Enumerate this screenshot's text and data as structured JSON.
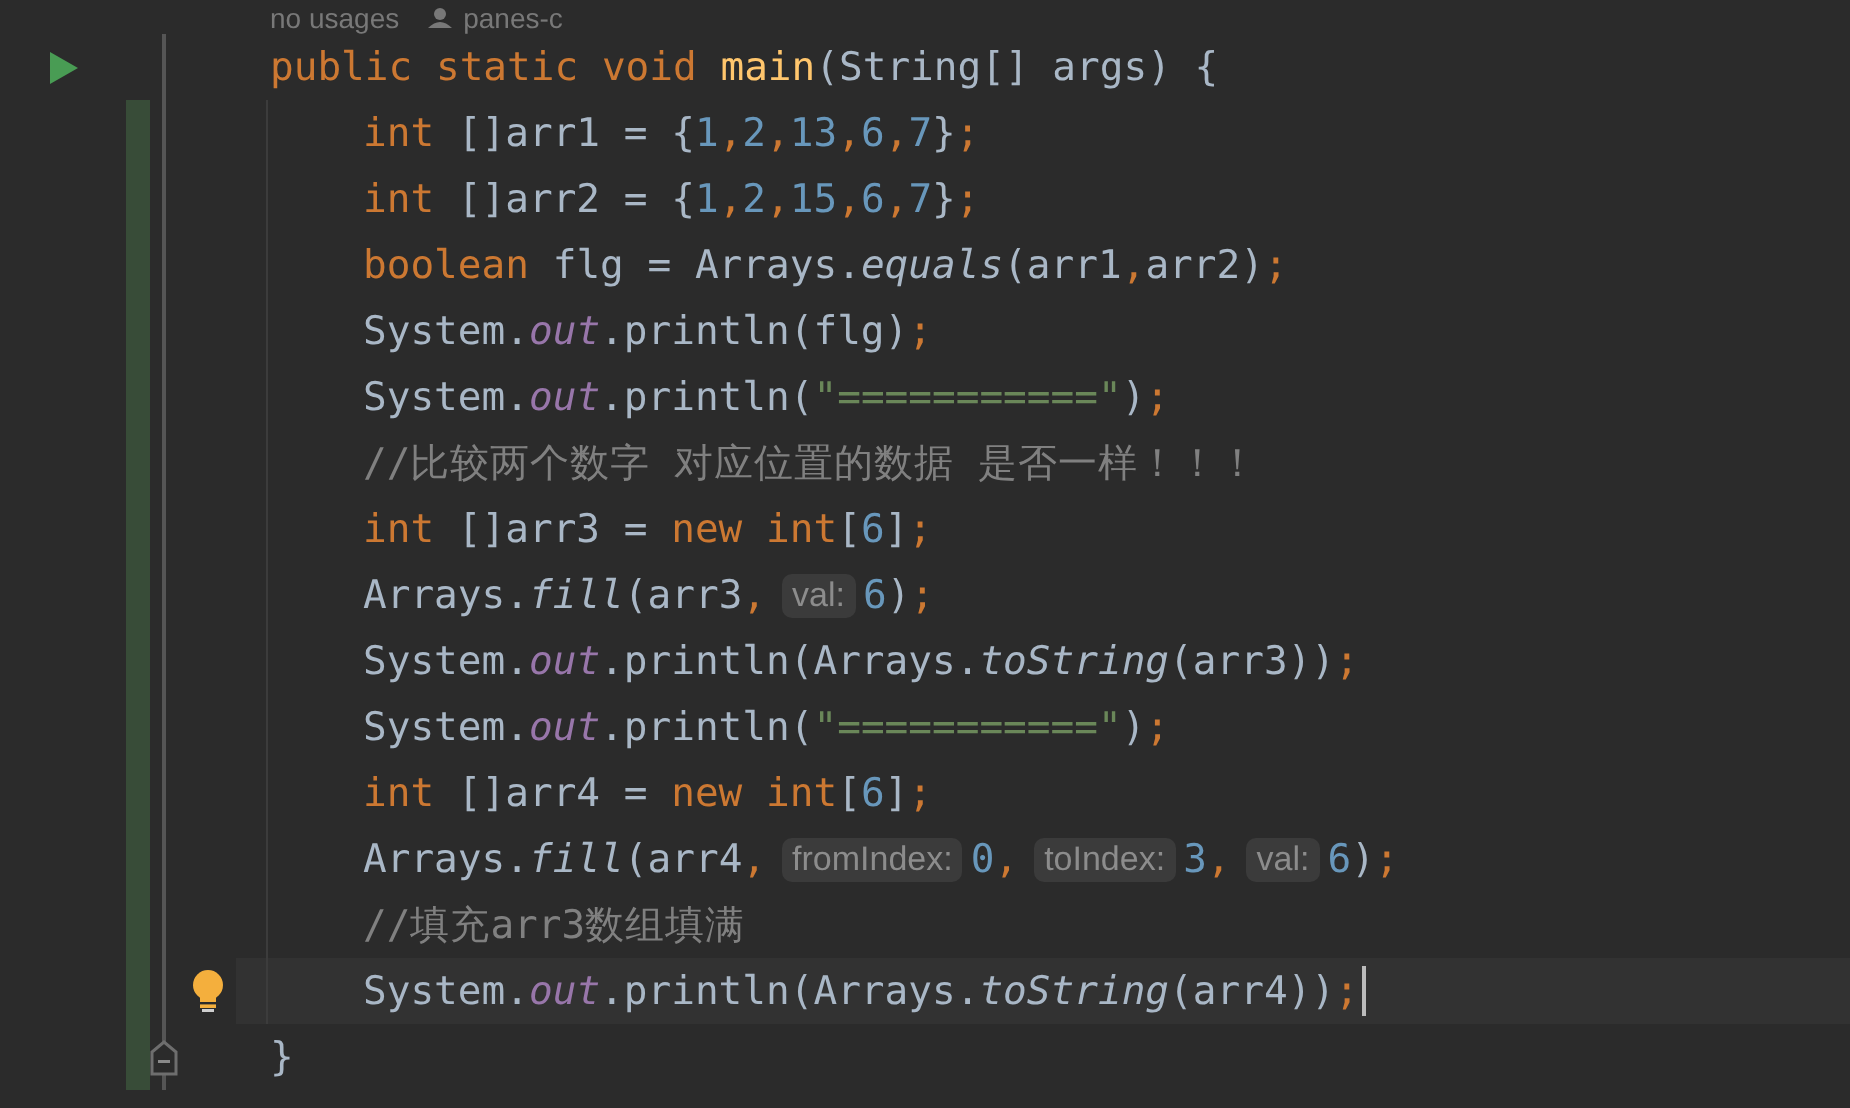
{
  "header": {
    "usages": "no usages",
    "author": "panes-c"
  },
  "lines": [
    {
      "marker": {
        "kind": "run"
      },
      "indented": false,
      "changed": false,
      "current": false,
      "tokens": [
        {
          "kind": "kw",
          "text": "public static void "
        },
        {
          "kind": "method",
          "text": "main"
        },
        {
          "kind": "plain",
          "text": "(String[] args) {"
        }
      ]
    },
    {
      "indented": true,
      "changed": true,
      "current": false,
      "tokens": [
        {
          "kind": "kw",
          "text": "int"
        },
        {
          "kind": "plain",
          "text": " []arr1 = {"
        },
        {
          "kind": "num",
          "text": "1"
        },
        {
          "kind": "kw",
          "text": ","
        },
        {
          "kind": "num",
          "text": "2"
        },
        {
          "kind": "kw",
          "text": ","
        },
        {
          "kind": "num",
          "text": "13"
        },
        {
          "kind": "kw",
          "text": ","
        },
        {
          "kind": "num",
          "text": "6"
        },
        {
          "kind": "kw",
          "text": ","
        },
        {
          "kind": "num",
          "text": "7"
        },
        {
          "kind": "plain",
          "text": "}"
        },
        {
          "kind": "kw",
          "text": ";"
        }
      ]
    },
    {
      "indented": true,
      "changed": true,
      "current": false,
      "tokens": [
        {
          "kind": "kw",
          "text": "int"
        },
        {
          "kind": "plain",
          "text": " []arr2 = {"
        },
        {
          "kind": "num",
          "text": "1"
        },
        {
          "kind": "kw",
          "text": ","
        },
        {
          "kind": "num",
          "text": "2"
        },
        {
          "kind": "kw",
          "text": ","
        },
        {
          "kind": "num",
          "text": "15"
        },
        {
          "kind": "kw",
          "text": ","
        },
        {
          "kind": "num",
          "text": "6"
        },
        {
          "kind": "kw",
          "text": ","
        },
        {
          "kind": "num",
          "text": "7"
        },
        {
          "kind": "plain",
          "text": "}"
        },
        {
          "kind": "kw",
          "text": ";"
        }
      ]
    },
    {
      "indented": true,
      "changed": true,
      "current": false,
      "tokens": [
        {
          "kind": "kw",
          "text": "boolean"
        },
        {
          "kind": "plain",
          "text": " flg = Arrays."
        },
        {
          "kind": "static",
          "text": "equals"
        },
        {
          "kind": "plain",
          "text": "(arr1"
        },
        {
          "kind": "kw",
          "text": ","
        },
        {
          "kind": "plain",
          "text": "arr2)"
        },
        {
          "kind": "kw",
          "text": ";"
        }
      ]
    },
    {
      "indented": true,
      "changed": true,
      "current": false,
      "tokens": [
        {
          "kind": "plain",
          "text": "System."
        },
        {
          "kind": "field",
          "text": "out"
        },
        {
          "kind": "plain",
          "text": ".println(flg)"
        },
        {
          "kind": "kw",
          "text": ";"
        }
      ]
    },
    {
      "indented": true,
      "changed": true,
      "current": false,
      "tokens": [
        {
          "kind": "plain",
          "text": "System."
        },
        {
          "kind": "field",
          "text": "out"
        },
        {
          "kind": "plain",
          "text": ".println("
        },
        {
          "kind": "str",
          "text": "\"===========\""
        },
        {
          "kind": "plain",
          "text": ")"
        },
        {
          "kind": "kw",
          "text": ";"
        }
      ]
    },
    {
      "indented": true,
      "changed": true,
      "current": false,
      "tokens": [
        {
          "kind": "comment",
          "text": "//比较两个数字 对应位置的数据 是否一样！！！"
        }
      ]
    },
    {
      "indented": true,
      "changed": true,
      "current": false,
      "tokens": [
        {
          "kind": "kw",
          "text": "int"
        },
        {
          "kind": "plain",
          "text": " []arr3 = "
        },
        {
          "kind": "kw",
          "text": "new int"
        },
        {
          "kind": "plain",
          "text": "["
        },
        {
          "kind": "num",
          "text": "6"
        },
        {
          "kind": "plain",
          "text": "]"
        },
        {
          "kind": "kw",
          "text": ";"
        }
      ]
    },
    {
      "indented": true,
      "changed": true,
      "current": false,
      "tokens": [
        {
          "kind": "plain",
          "text": "Arrays."
        },
        {
          "kind": "static",
          "text": "fill"
        },
        {
          "kind": "plain",
          "text": "(arr3"
        },
        {
          "kind": "kw",
          "text": ","
        },
        {
          "kind": "hint",
          "text": "val:"
        },
        {
          "kind": "num",
          "text": "6"
        },
        {
          "kind": "plain",
          "text": ")"
        },
        {
          "kind": "kw",
          "text": ";"
        }
      ]
    },
    {
      "indented": true,
      "changed": true,
      "current": false,
      "tokens": [
        {
          "kind": "plain",
          "text": "System."
        },
        {
          "kind": "field",
          "text": "out"
        },
        {
          "kind": "plain",
          "text": ".println(Arrays."
        },
        {
          "kind": "static",
          "text": "toString"
        },
        {
          "kind": "plain",
          "text": "(arr3))"
        },
        {
          "kind": "kw",
          "text": ";"
        }
      ]
    },
    {
      "indented": true,
      "changed": true,
      "current": false,
      "tokens": [
        {
          "kind": "plain",
          "text": "System."
        },
        {
          "kind": "field",
          "text": "out"
        },
        {
          "kind": "plain",
          "text": ".println("
        },
        {
          "kind": "str",
          "text": "\"===========\""
        },
        {
          "kind": "plain",
          "text": ")"
        },
        {
          "kind": "kw",
          "text": ";"
        }
      ]
    },
    {
      "indented": true,
      "changed": true,
      "current": false,
      "tokens": [
        {
          "kind": "kw",
          "text": "int"
        },
        {
          "kind": "plain",
          "text": " []arr4 = "
        },
        {
          "kind": "kw",
          "text": "new int"
        },
        {
          "kind": "plain",
          "text": "["
        },
        {
          "kind": "num",
          "text": "6"
        },
        {
          "kind": "plain",
          "text": "]"
        },
        {
          "kind": "kw",
          "text": ";"
        }
      ]
    },
    {
      "indented": true,
      "changed": true,
      "current": false,
      "tokens": [
        {
          "kind": "plain",
          "text": "Arrays."
        },
        {
          "kind": "static",
          "text": "fill"
        },
        {
          "kind": "plain",
          "text": "(arr4"
        },
        {
          "kind": "kw",
          "text": ","
        },
        {
          "kind": "hint",
          "text": "fromIndex:"
        },
        {
          "kind": "num",
          "text": "0"
        },
        {
          "kind": "kw",
          "text": ","
        },
        {
          "kind": "hint",
          "text": "toIndex:"
        },
        {
          "kind": "num",
          "text": "3"
        },
        {
          "kind": "kw",
          "text": ","
        },
        {
          "kind": "hint",
          "text": "val:"
        },
        {
          "kind": "num",
          "text": "6"
        },
        {
          "kind": "plain",
          "text": ")"
        },
        {
          "kind": "kw",
          "text": ";"
        }
      ]
    },
    {
      "indented": true,
      "changed": true,
      "current": false,
      "tokens": [
        {
          "kind": "comment",
          "text": "//填充arr3数组填满"
        }
      ]
    },
    {
      "marker": {
        "kind": "bulb"
      },
      "indented": true,
      "changed": true,
      "current": true,
      "tokens": [
        {
          "kind": "plain",
          "text": "System."
        },
        {
          "kind": "field",
          "text": "out"
        },
        {
          "kind": "plain",
          "text": ".println(Arrays."
        },
        {
          "kind": "static",
          "text": "toString"
        },
        {
          "kind": "plain",
          "text": "(arr4))"
        },
        {
          "kind": "kw",
          "text": ";"
        }
      ]
    },
    {
      "marker": {
        "kind": "fold-end"
      },
      "indented": false,
      "changed": true,
      "current": false,
      "tokens": [
        {
          "kind": "plain",
          "text": "}"
        }
      ]
    }
  ]
}
